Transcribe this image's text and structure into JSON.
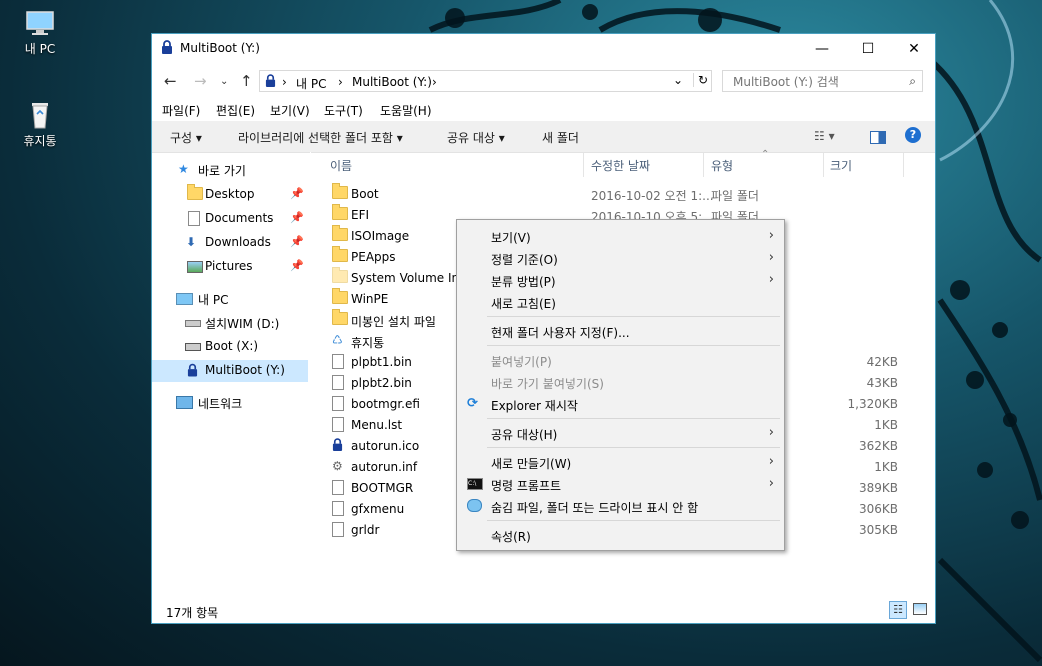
{
  "desktop": {
    "icons": [
      {
        "label": "내 PC"
      },
      {
        "label": "휴지통"
      }
    ]
  },
  "window": {
    "title": "MultiBoot (Y:)",
    "minimize": "—",
    "maximize": "☐",
    "close": "✕",
    "address": {
      "segments": [
        "내 PC",
        "MultiBoot (Y:)"
      ],
      "separator": "›"
    },
    "search": {
      "placeholder": "MultiBoot (Y:) 검색"
    },
    "menubar": [
      "파일(F)",
      "편집(E)",
      "보기(V)",
      "도구(T)",
      "도움말(H)"
    ],
    "commands": [
      "구성 ▾",
      "라이브러리에 선택한 폴더 포함 ▾",
      "공유 대상 ▾",
      "새 폴더"
    ],
    "nav": {
      "quick_access": "바로 가기",
      "quick_items": [
        "Desktop",
        "Documents",
        "Downloads",
        "Pictures"
      ],
      "this_pc": "내 PC",
      "drives": [
        "설치WIM (D:)",
        "Boot (X:)",
        "MultiBoot (Y:)"
      ],
      "network": "네트워크"
    },
    "columns": {
      "name": "이름",
      "date": "수정한 날짜",
      "type": "유형",
      "size": "크기"
    },
    "files": [
      {
        "name": "Boot",
        "date": "2016-10-02 오전 1:...",
        "type": "파일 폴더",
        "size": "",
        "kind": "folder"
      },
      {
        "name": "EFI",
        "date": "2016-10-10 오후 5:...",
        "type": "파일 폴더",
        "size": "",
        "kind": "folder"
      },
      {
        "name": "ISOImage",
        "date": "",
        "type": "",
        "size": "",
        "kind": "folder"
      },
      {
        "name": "PEApps",
        "date": "",
        "type": "",
        "size": "",
        "kind": "folder"
      },
      {
        "name": "System Volume Info",
        "date": "",
        "type": "",
        "size": "",
        "kind": "folder-light"
      },
      {
        "name": "WinPE",
        "date": "",
        "type": "",
        "size": "",
        "kind": "folder"
      },
      {
        "name": "미봉인 설치 파일",
        "date": "",
        "type": "",
        "size": "",
        "kind": "folder"
      },
      {
        "name": "휴지통",
        "date": "",
        "type": "",
        "size": "",
        "kind": "recycle"
      },
      {
        "name": "plpbt1.bin",
        "date": "",
        "type": "",
        "size": "42KB",
        "kind": "doc"
      },
      {
        "name": "plpbt2.bin",
        "date": "",
        "type": "",
        "size": "43KB",
        "kind": "doc"
      },
      {
        "name": "bootmgr.efi",
        "date": "",
        "type": "",
        "size": "1,320KB",
        "kind": "doc"
      },
      {
        "name": "Menu.lst",
        "date": "",
        "type": "",
        "size": "1KB",
        "kind": "doc"
      },
      {
        "name": "autorun.ico",
        "date": "",
        "type": "",
        "size": "362KB",
        "kind": "lock"
      },
      {
        "name": "autorun.inf",
        "date": "",
        "type": "",
        "size": "1KB",
        "kind": "gear"
      },
      {
        "name": "BOOTMGR",
        "date": "",
        "type": "",
        "size": "389KB",
        "kind": "doc"
      },
      {
        "name": "gfxmenu",
        "date": "",
        "type": "",
        "size": "306KB",
        "kind": "doc"
      },
      {
        "name": "grldr",
        "date": "",
        "type": "",
        "size": "305KB",
        "kind": "doc"
      }
    ],
    "status": "17개 항목"
  },
  "context_menu": {
    "items": [
      {
        "label": "보기(V)",
        "submenu": true,
        "disabled": false
      },
      {
        "label": "정렬 기준(O)",
        "submenu": true,
        "disabled": false
      },
      {
        "label": "분류 방법(P)",
        "submenu": true,
        "disabled": false
      },
      {
        "label": "새로 고침(E)",
        "submenu": false,
        "disabled": false
      },
      {
        "label": "현재 폴더 사용자 지정(F)...",
        "submenu": false,
        "disabled": false
      },
      {
        "label": "붙여넣기(P)",
        "submenu": false,
        "disabled": true
      },
      {
        "label": "바로 가기 붙여넣기(S)",
        "submenu": false,
        "disabled": true
      },
      {
        "label": "Explorer 재시작",
        "submenu": false,
        "disabled": false,
        "icon": "refresh-icon"
      },
      {
        "label": "공유 대상(H)",
        "submenu": true,
        "disabled": false
      },
      {
        "label": "새로 만들기(W)",
        "submenu": true,
        "disabled": false
      },
      {
        "label": "명령 프롬프트",
        "submenu": true,
        "disabled": false,
        "icon": "cmd-icon"
      },
      {
        "label": "숨김 파일, 폴더 또는 드라이브 표시 안 함",
        "submenu": false,
        "disabled": false,
        "icon": "chat-icon"
      },
      {
        "label": "속성(R)",
        "submenu": false,
        "disabled": false
      }
    ]
  },
  "colors": {
    "accent": "#1e90c8",
    "selection": "#cce8ff"
  }
}
